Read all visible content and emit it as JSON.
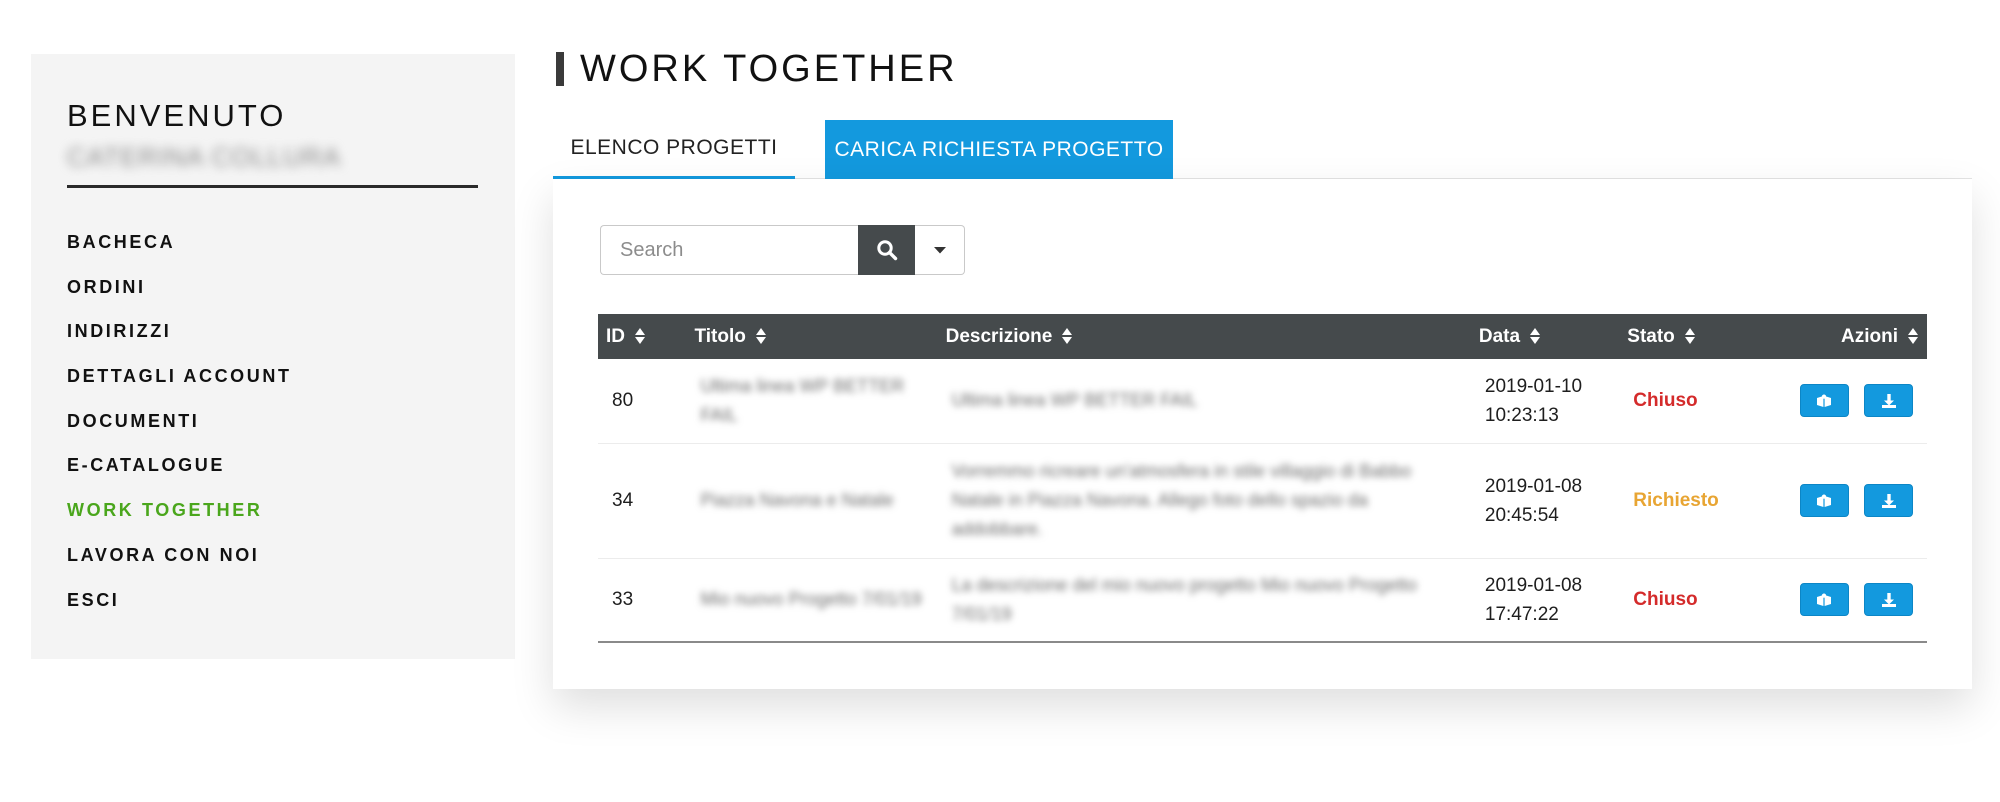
{
  "sidebar": {
    "welcome": "BENVENUTO",
    "username": "CATERINA COLLURA",
    "menu": [
      {
        "label": "BACHECA"
      },
      {
        "label": "ORDINI"
      },
      {
        "label": "INDIRIZZI"
      },
      {
        "label": "DETTAGLI ACCOUNT"
      },
      {
        "label": "DOCUMENTI"
      },
      {
        "label": "E-CATALOGUE"
      },
      {
        "label": "WORK TOGETHER"
      },
      {
        "label": "LAVORA CON NOI"
      },
      {
        "label": "ESCI"
      }
    ],
    "active_item": "WORK TOGETHER",
    "active_color": "#4aa61c"
  },
  "page_title": "WORK TOGETHER",
  "tabs": {
    "list_label": "ELENCO PROGETTI",
    "upload_label": "CARICA RICHIESTA PROGETTO",
    "accent_color": "#1399de"
  },
  "search": {
    "placeholder": "Search",
    "value": "",
    "search_icon": "search-icon",
    "dropdown_icon": "caret-down-icon"
  },
  "table": {
    "columns": [
      "ID",
      "Titolo",
      "Descrizione",
      "Data",
      "Stato",
      "Azioni"
    ],
    "rows": [
      {
        "id": "80",
        "titolo": "Ultima linea WP BETTER FAIL",
        "descrizione": "Ultima linea WP BETTER FAIL",
        "data_line1": "2019-01-10",
        "data_line2": "10:23:13",
        "stato": "Chiuso",
        "stato_color": "#d42b2b"
      },
      {
        "id": "34",
        "titolo": "Piazza Navona e Natale",
        "descrizione": "Vorremmo ricreare un'atmosfera in stile villaggio di Babbo Natale in Piazza Navona. Allego foto dello spazio da addobbare.",
        "data_line1": "2019-01-08",
        "data_line2": "20:45:54",
        "stato": "Richiesto",
        "stato_color": "#e8a533"
      },
      {
        "id": "33",
        "titolo": "Mio nuovo Progetto 7/01/19",
        "descrizione": "La descrizione del mio nuovo progetto Mio nuovo Progetto 7/01/19",
        "data_line1": "2019-01-08",
        "data_line2": "17:47:22",
        "stato": "Chiuso",
        "stato_color": "#d42b2b"
      }
    ],
    "action_icons": [
      "view-book-icon",
      "download-icon"
    ],
    "header_bg": "#454a4c"
  }
}
